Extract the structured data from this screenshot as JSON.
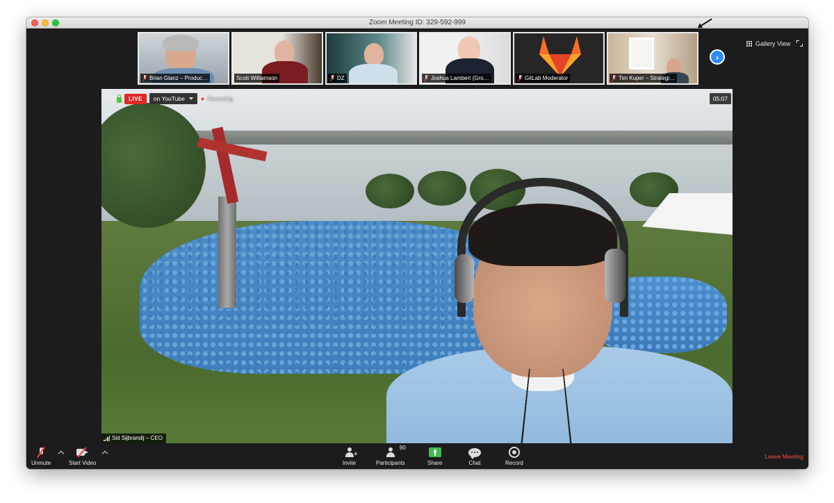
{
  "window": {
    "title": "Zoom Meeting ID: 329-592-999"
  },
  "header": {
    "gallery_view_label": "Gallery View"
  },
  "participants_strip": [
    {
      "name": "Brian Glanz – Produc…",
      "muted": true
    },
    {
      "name": "Scott Williamson",
      "muted": false
    },
    {
      "name": "DZ",
      "muted": true
    },
    {
      "name": "Joshua Lambert (Gro…",
      "muted": true
    },
    {
      "name": "GitLab Moderator",
      "muted": true
    },
    {
      "name": "Tim Kuper – Strategi…",
      "muted": true
    }
  ],
  "stage": {
    "live_badge": "LIVE",
    "live_destination": "on YouTube",
    "recording_label": "Recording",
    "timer": "05:07",
    "speaker_name": "Sid Sijbrandij – CEO"
  },
  "toolbar": {
    "unmute_label": "Unmute",
    "start_video_label": "Start Video",
    "invite_label": "Invite",
    "participants_label": "Participants",
    "participants_count": "90",
    "share_label": "Share",
    "chat_label": "Chat",
    "record_label": "Record",
    "leave_label": "Leave Meeting"
  },
  "colors": {
    "live": "#e02828",
    "share": "#3fb950",
    "leave": "#ff4b3e",
    "accent": "#2d8cff"
  }
}
